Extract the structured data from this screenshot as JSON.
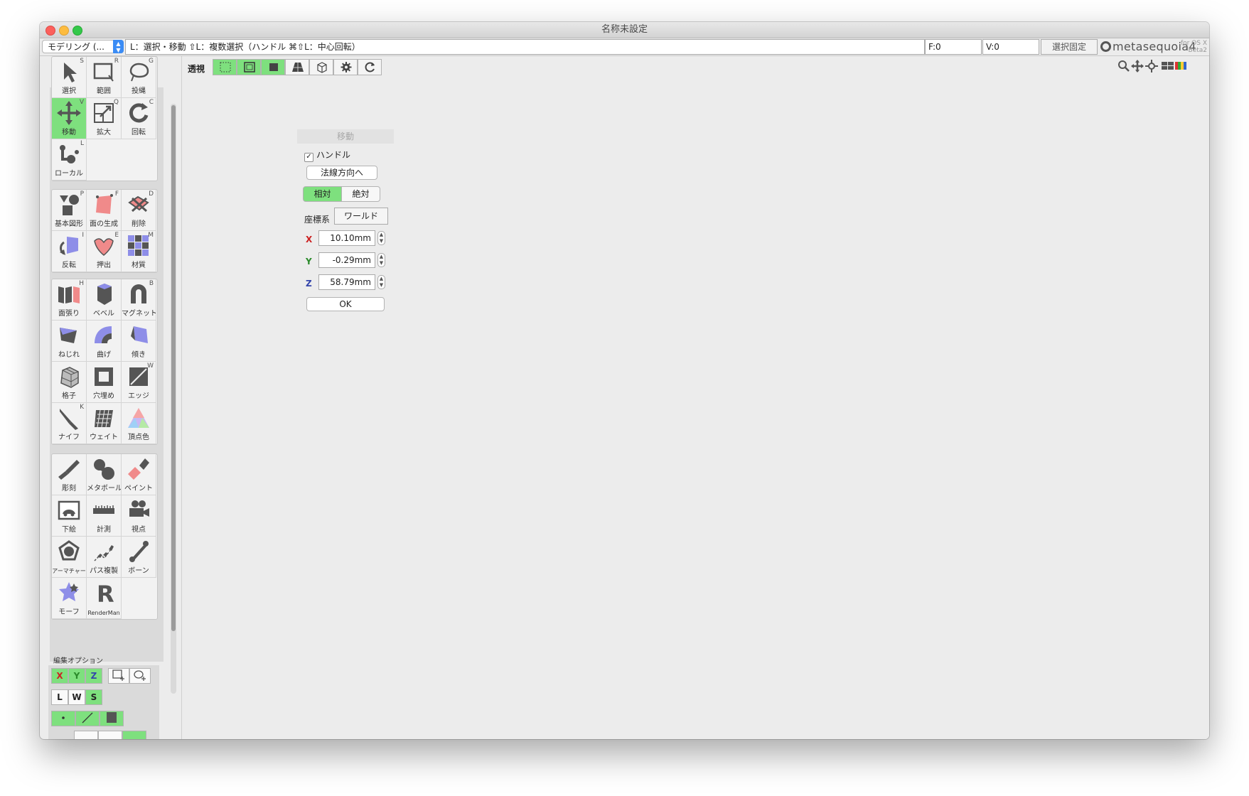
{
  "window": {
    "title": "名称未設定"
  },
  "statusbar": {
    "mode": "モデリング (...",
    "hint": "L：選択・移動  ⇧L：複数選択（ハンドル  ⌘⇧L：中心回転）",
    "face_count": "F:0",
    "vertex_count": "V:0",
    "lock_label": "選択固定",
    "logo": "metasequoia4",
    "logo_sub1": "for OS X",
    "logo_sub2": "Beta2"
  },
  "tools": [
    {
      "label": "選択",
      "key": "S",
      "icon": "cursor-arrow-icon",
      "active": false
    },
    {
      "label": "範囲",
      "key": "R",
      "icon": "rect-select-icon",
      "active": false
    },
    {
      "label": "投縄",
      "key": "G",
      "icon": "lasso-icon",
      "active": false
    },
    {
      "label": "移動",
      "key": "V",
      "icon": "move-arrows-icon",
      "active": true
    },
    {
      "label": "拡大",
      "key": "Q",
      "icon": "scale-icon",
      "active": false
    },
    {
      "label": "回転",
      "key": "C",
      "icon": "rotate-icon",
      "active": false
    },
    {
      "label": "ローカル",
      "key": "L",
      "icon": "local-icon",
      "active": false
    },
    {
      "label": "基本図形",
      "key": "P",
      "icon": "primitive-icon",
      "active": false
    },
    {
      "label": "面の生成",
      "key": "F",
      "icon": "create-face-icon",
      "active": false
    },
    {
      "label": "削除",
      "key": "D",
      "icon": "delete-icon",
      "active": false
    },
    {
      "label": "反転",
      "key": "I",
      "icon": "flip-icon",
      "active": false
    },
    {
      "label": "押出",
      "key": "E",
      "icon": "extrude-icon",
      "active": false
    },
    {
      "label": "材質",
      "key": "M",
      "icon": "material-icon",
      "active": false
    },
    {
      "label": "面張り",
      "key": "H",
      "icon": "face-fill-icon",
      "active": false
    },
    {
      "label": "ベベル",
      "key": "",
      "icon": "bevel-icon",
      "active": false
    },
    {
      "label": "マグネット",
      "key": "B",
      "icon": "magnet-icon",
      "active": false
    },
    {
      "label": "ねじれ",
      "key": "",
      "icon": "twist-icon",
      "active": false
    },
    {
      "label": "曲げ",
      "key": "",
      "icon": "bend-icon",
      "active": false
    },
    {
      "label": "傾き",
      "key": "",
      "icon": "skew-icon",
      "active": false
    },
    {
      "label": "格子",
      "key": "",
      "icon": "lattice-icon",
      "active": false
    },
    {
      "label": "穴埋め",
      "key": "",
      "icon": "fill-hole-icon",
      "active": false
    },
    {
      "label": "エッジ",
      "key": "W",
      "icon": "edge-icon",
      "active": false
    },
    {
      "label": "ナイフ",
      "key": "K",
      "icon": "knife-icon",
      "active": false
    },
    {
      "label": "ウェイト",
      "key": "",
      "icon": "weight-icon",
      "active": false
    },
    {
      "label": "頂点色",
      "key": "",
      "icon": "vertex-color-icon",
      "active": false
    },
    {
      "label": "彫刻",
      "key": "",
      "icon": "sculpt-icon",
      "active": false
    },
    {
      "label": "メタボール",
      "key": "",
      "icon": "metaball-icon",
      "active": false
    },
    {
      "label": "ペイント",
      "key": "",
      "icon": "paint-icon",
      "active": false
    },
    {
      "label": "下絵",
      "key": "",
      "icon": "underlay-icon",
      "active": false
    },
    {
      "label": "計測",
      "key": "",
      "icon": "measure-icon",
      "active": false
    },
    {
      "label": "視点",
      "key": "",
      "icon": "camera-icon",
      "active": false
    },
    {
      "label": "アーマチャー",
      "key": "",
      "icon": "armature-icon",
      "active": false
    },
    {
      "label": "パス複製",
      "key": "",
      "icon": "path-dup-icon",
      "active": false
    },
    {
      "label": "ボーン",
      "key": "",
      "icon": "bone-icon",
      "active": false
    },
    {
      "label": "モーフ",
      "key": "",
      "icon": "morph-icon",
      "active": false
    },
    {
      "label": "RenderMan",
      "key": "",
      "icon": "renderman-icon",
      "active": false
    }
  ],
  "edit_options": {
    "label": "編集オプション",
    "x": "X",
    "y": "Y",
    "z": "Z",
    "l": "L",
    "w": "W",
    "s": "S"
  },
  "viewport": {
    "label": "透視"
  },
  "move_panel": {
    "title": "移動",
    "handle_label": "ハンドル",
    "handle_checked": true,
    "normal_button": "法線方向へ",
    "relative": "相対",
    "absolute": "絶対",
    "coord_label": "座標系",
    "coord_value": "ワールド",
    "x_label": "X",
    "x_value": "10.10mm",
    "y_label": "Y",
    "y_value": "-0.29mm",
    "z_label": "Z",
    "z_value": "58.79mm",
    "ok": "OK"
  },
  "colors": {
    "accent_green": "#7ee07e",
    "x_axis": "#cc2222",
    "y_axis": "#2a8a2a",
    "z_axis": "#3344aa"
  }
}
